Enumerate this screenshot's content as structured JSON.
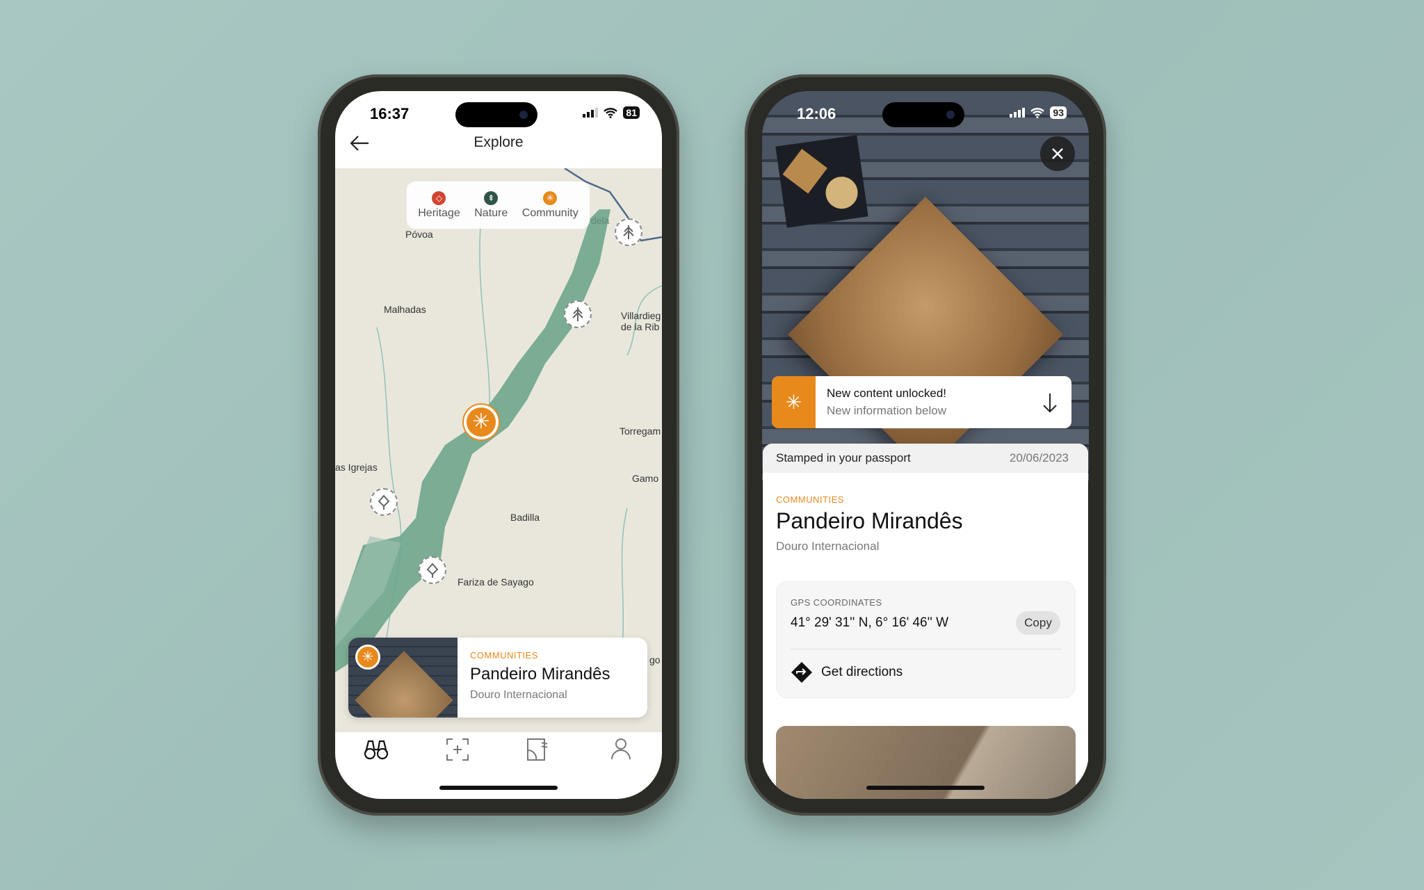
{
  "left_phone": {
    "status": {
      "time": "16:37",
      "battery": "81"
    },
    "header": {
      "title": "Explore",
      "back_icon": "arrow-left-icon"
    },
    "legend": [
      {
        "label": "Heritage",
        "color": "#d0442f",
        "icon": "heritage-icon"
      },
      {
        "label": "Nature",
        "color": "#2f5548",
        "icon": "tree-icon"
      },
      {
        "label": "Community",
        "color": "#e8891c",
        "icon": "asterisk-icon"
      }
    ],
    "map_labels": {
      "povoa": "Póvoa",
      "malhadas": "Malhadas",
      "villardiego1": "Villardieg",
      "villardiego2": "de la Rib",
      "torregam": "Torregam",
      "gamo": "Gamo",
      "igrejas": "as Igrejas",
      "badilla": "Badilla",
      "fariza": "Fariza de Sayago",
      "go": "go",
      "dela": "dela"
    },
    "card": {
      "category": "COMMUNITIES",
      "title": "Pandeiro Mirandês",
      "subtitle": "Douro Internacional"
    },
    "nav": [
      {
        "icon": "binoculars-icon",
        "active": true
      },
      {
        "icon": "scan-add-icon"
      },
      {
        "icon": "map-icon"
      },
      {
        "icon": "profile-icon"
      }
    ]
  },
  "right_phone": {
    "status": {
      "time": "12:06",
      "battery": "93"
    },
    "banner": {
      "title": "New content unlocked!",
      "subtitle": "New information below"
    },
    "stamp": {
      "label": "Stamped in your passport",
      "date": "20/06/2023"
    },
    "detail": {
      "category": "COMMUNITIES",
      "title": "Pandeiro Mirandês",
      "subtitle": "Douro Internacional"
    },
    "gps": {
      "label": "GPS COORDINATES",
      "value": "41° 29' 31'' N, 6° 16' 46'' W",
      "copy": "Copy",
      "directions": "Get directions"
    }
  },
  "colors": {
    "accent": "#e8891c",
    "river": "#6fa58c",
    "map_bg": "#e9e7dc"
  }
}
